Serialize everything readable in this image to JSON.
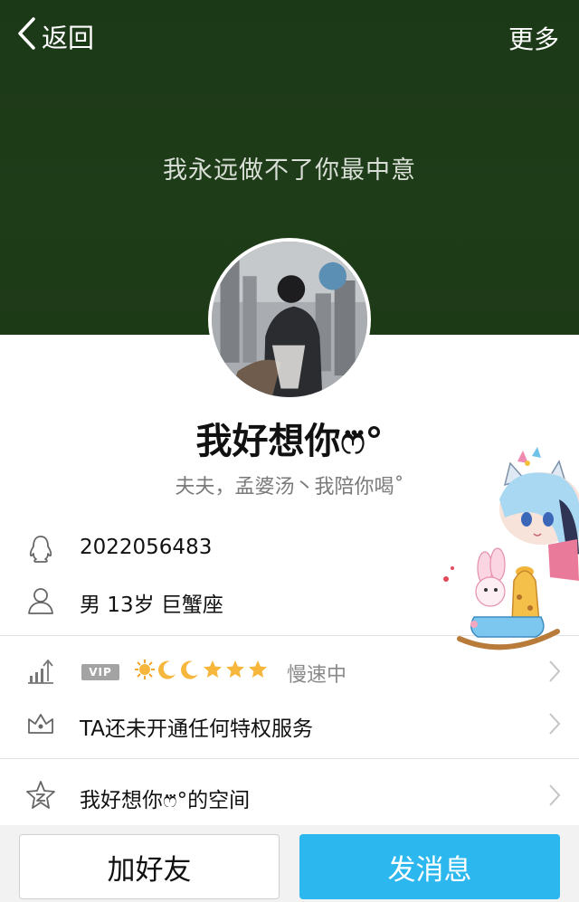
{
  "header": {
    "back_label": "返回",
    "more_label": "更多"
  },
  "cover": {
    "text": "我永远做不了你最中意",
    "color": "#1d3a17"
  },
  "profile": {
    "nickname": "我好想你ෆ⃛°",
    "signature": "夫夫，孟婆汤丶我陪你喝˚",
    "qq_number": "2022056483",
    "gender_age_sign": "男  13岁  巨蟹座"
  },
  "vip": {
    "badge": "VIP",
    "levels": [
      "sun",
      "moon",
      "moon",
      "star",
      "star",
      "star"
    ],
    "speed_text": "慢速中"
  },
  "privilege": {
    "text": "TA还未开通任何特权服务"
  },
  "space": {
    "text": "我好想你ෆ⃛°的空间"
  },
  "actions": {
    "add_friend": "加好友",
    "send_message": "发消息",
    "accent_color": "#2cb8ee"
  },
  "icons": {
    "back": "chevron-left-icon",
    "qq": "penguin-icon",
    "user": "user-icon",
    "level": "level-chart-icon",
    "privilege": "crown-icon",
    "space": "qzone-star-icon",
    "chevron": "chevron-right-icon"
  }
}
